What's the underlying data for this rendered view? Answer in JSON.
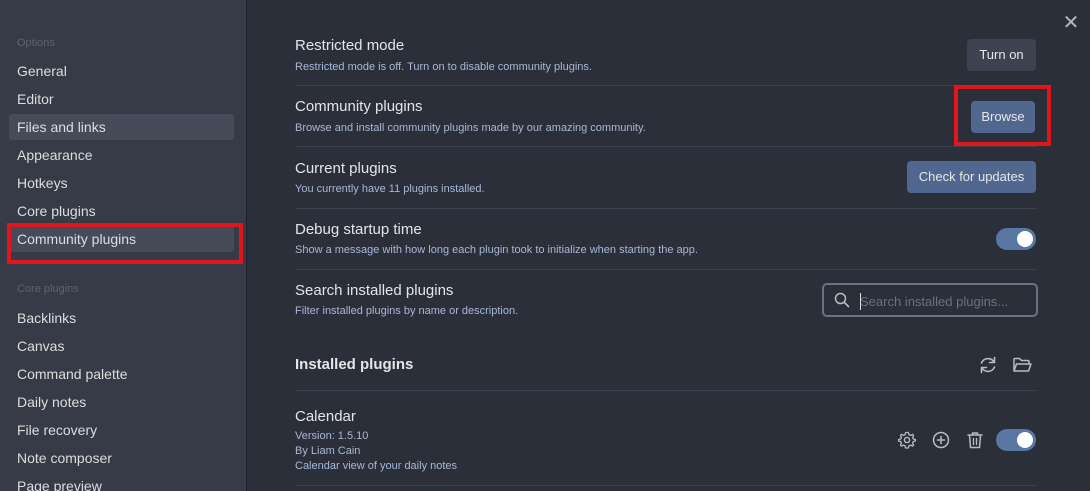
{
  "sidebar": {
    "options_heading": "Options",
    "options_items": [
      {
        "label": "General"
      },
      {
        "label": "Editor"
      },
      {
        "label": "Files and links"
      },
      {
        "label": "Appearance"
      },
      {
        "label": "Hotkeys"
      },
      {
        "label": "Core plugins"
      },
      {
        "label": "Community plugins"
      }
    ],
    "core_heading": "Core plugins",
    "core_items": [
      {
        "label": "Backlinks"
      },
      {
        "label": "Canvas"
      },
      {
        "label": "Command palette"
      },
      {
        "label": "Daily notes"
      },
      {
        "label": "File recovery"
      },
      {
        "label": "Note composer"
      },
      {
        "label": "Page preview"
      }
    ]
  },
  "settings": {
    "restricted_mode": {
      "name": "Restricted mode",
      "desc": "Restricted mode is off. Turn on to disable community plugins.",
      "button": "Turn on"
    },
    "community_plugins": {
      "name": "Community plugins",
      "desc": "Browse and install community plugins made by our amazing community.",
      "button": "Browse"
    },
    "current_plugins": {
      "name": "Current plugins",
      "desc": "You currently have 11 plugins installed.",
      "button": "Check for updates"
    },
    "debug_startup": {
      "name": "Debug startup time",
      "desc": "Show a message with how long each plugin took to initialize when starting the app.",
      "enabled": true
    },
    "search_installed": {
      "name": "Search installed plugins",
      "desc": "Filter installed plugins by name or description.",
      "placeholder": "Search installed plugins...",
      "value": ""
    }
  },
  "installed": {
    "heading": "Installed plugins",
    "reload_icon": "reload-icon",
    "folder_icon": "folder-open-icon",
    "plugins": [
      {
        "name": "Calendar",
        "version": "Version: 1.5.10",
        "author": "By Liam Cain",
        "desc": "Calendar view of your daily notes",
        "enabled": true
      }
    ]
  },
  "colors": {
    "accent": "#52678f",
    "highlight": "#e2141c",
    "toggle_on": "#5a76a3"
  },
  "close_glyph": "✕"
}
